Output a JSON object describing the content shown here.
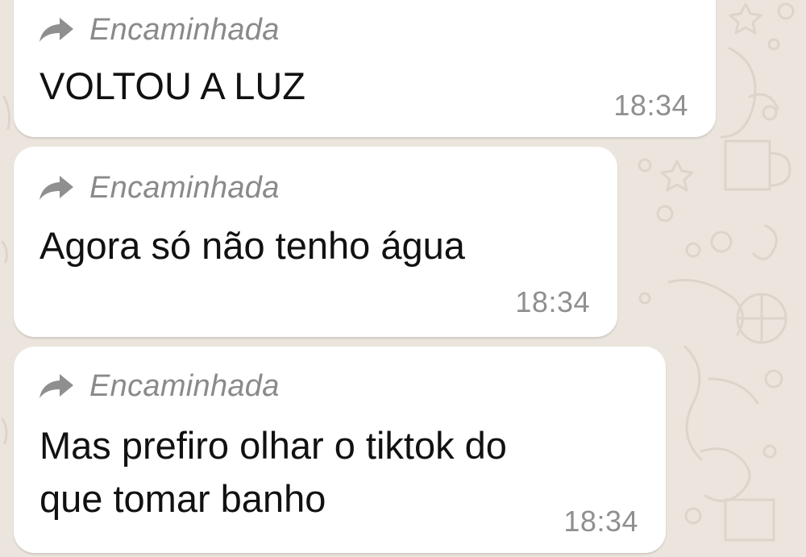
{
  "chat": {
    "messages": [
      {
        "forwarded_label": "Encaminhada",
        "forward_icon": "forward-arrow-icon",
        "text": "VOLTOU A LUZ",
        "time": "18:34"
      },
      {
        "forwarded_label": "Encaminhada",
        "forward_icon": "forward-arrow-icon",
        "text": "Agora só não tenho água",
        "time": "18:34"
      },
      {
        "forwarded_label": "Encaminhada",
        "forward_icon": "forward-arrow-icon",
        "text": "Mas prefiro olhar o tiktok do\nque tomar banho",
        "time": "18:34"
      }
    ]
  },
  "colors": {
    "wallpaper": "#ece5dd",
    "bubble": "#ffffff",
    "meta_text": "#8a8a8a"
  }
}
